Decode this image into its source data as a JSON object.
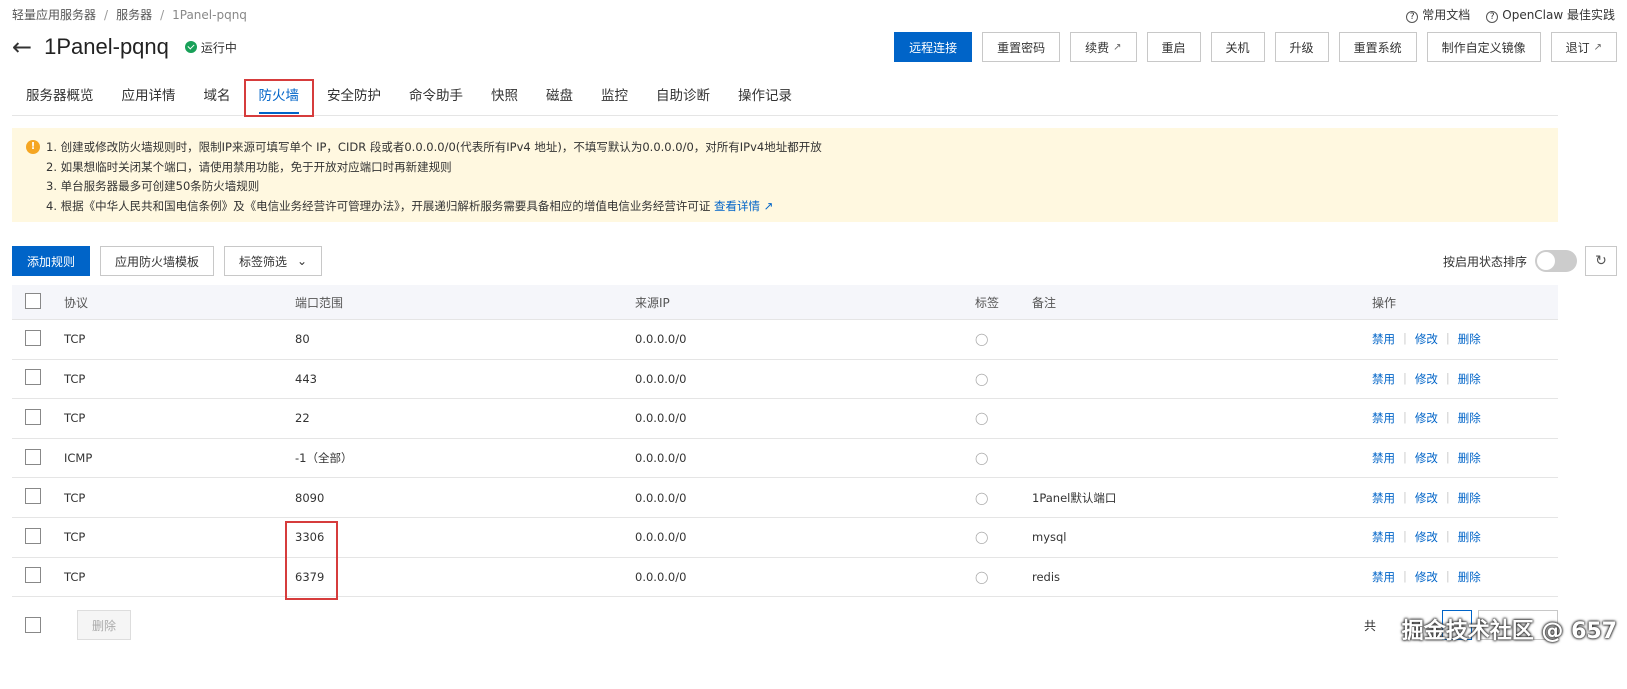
{
  "breadcrumb": [
    "轻量应用服务器",
    "服务器",
    "1Panel-pqnq"
  ],
  "top_links": {
    "docs": "常用文档",
    "openclaw": "OpenClaw 最佳实践"
  },
  "title": "1Panel-pqnq",
  "status": "运行中",
  "actions": {
    "remote": "远程连接",
    "reset_pwd": "重置密码",
    "renew": "续费",
    "restart": "重启",
    "shutdown": "关机",
    "upgrade": "升级",
    "reset_system": "重置系统",
    "custom_image": "制作自定义镜像",
    "unsubscribe": "退订"
  },
  "tabs": [
    "服务器概览",
    "应用详情",
    "域名",
    "防火墙",
    "安全防护",
    "命令助手",
    "快照",
    "磁盘",
    "监控",
    "自助诊断",
    "操作记录"
  ],
  "active_tab": "防火墙",
  "notice": {
    "line1": "1. 创建或修改防火墙规则时，限制IP来源可填写单个 IP，CIDR 段或者0.0.0.0/0(代表所有IPv4 地址)，不填写默认为0.0.0.0/0，对所有IPv4地址都开放",
    "line2": "2. 如果想临时关闭某个端口，请使用禁用功能，免于开放对应端口时再新建规则",
    "line3": "3. 单台服务器最多可创建50条防火墙规则",
    "line4": "4. 根据《中华人民共和国电信条例》及《电信业务经营许可管理办法》，开展递归解析服务需要具备相应的增值电信业务经营许可证",
    "link": "查看详情"
  },
  "toolbar": {
    "add": "添加规则",
    "template": "应用防火墙模板",
    "tag_filter": "标签筛选",
    "sort_label": "按启用状态排序"
  },
  "columns": {
    "protocol": "协议",
    "port": "端口范围",
    "source": "来源IP",
    "tag": "标签",
    "note": "备注",
    "ops": "操作"
  },
  "op_labels": {
    "disable": "禁用",
    "edit": "修改",
    "delete": "删除"
  },
  "rows": [
    {
      "protocol": "TCP",
      "port": "80",
      "source": "0.0.0.0/0",
      "note": ""
    },
    {
      "protocol": "TCP",
      "port": "443",
      "source": "0.0.0.0/0",
      "note": ""
    },
    {
      "protocol": "TCP",
      "port": "22",
      "source": "0.0.0.0/0",
      "note": ""
    },
    {
      "protocol": "ICMP",
      "port": "-1（全部）",
      "source": "0.0.0.0/0",
      "note": ""
    },
    {
      "protocol": "TCP",
      "port": "8090",
      "source": "0.0.0.0/0",
      "note": "1Panel默认端口"
    },
    {
      "protocol": "TCP",
      "port": "3306",
      "source": "0.0.0.0/0",
      "note": "mysql"
    },
    {
      "protocol": "TCP",
      "port": "6379",
      "source": "0.0.0.0/0",
      "note": "redis"
    }
  ],
  "footer": {
    "delete": "删除",
    "total_prefix": "共"
  },
  "watermark": "掘金技术社区 @ 657"
}
